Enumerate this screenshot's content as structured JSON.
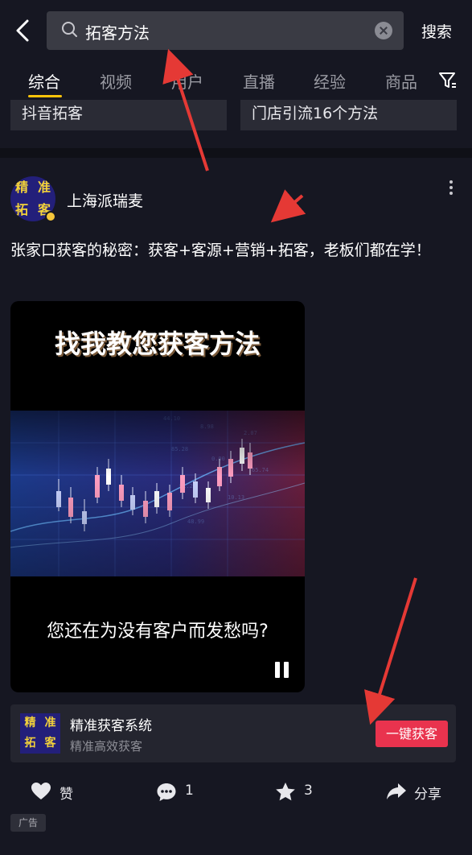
{
  "search": {
    "query": "拓客方法",
    "submit_label": "搜索"
  },
  "tabs": [
    {
      "label": "综合",
      "active": true
    },
    {
      "label": "视频",
      "active": false
    },
    {
      "label": "用户",
      "active": false
    },
    {
      "label": "直播",
      "active": false
    },
    {
      "label": "经验",
      "active": false
    },
    {
      "label": "商品",
      "active": false
    }
  ],
  "related": [
    {
      "label": "抖音拓客"
    },
    {
      "label": "门店引流16个方法"
    }
  ],
  "post": {
    "username": "上海派瑞麦",
    "avatar_text": [
      "精",
      "准",
      "拓",
      "客"
    ],
    "description": "张家口获客的秘密：获客+客源+营销+拓客，老板们都在学！",
    "video": {
      "title": "找我教您获客方法",
      "subtitle": "您还在为没有客户而发愁吗?",
      "state": "playing"
    }
  },
  "ad": {
    "logo_text": [
      "精",
      "准",
      "拓",
      "客"
    ],
    "title": "精准获客系统",
    "subtitle": "精准高效获客",
    "button_label": "一键获客",
    "tag": "广告"
  },
  "actions": {
    "like_label": "赞",
    "comment_count": "1",
    "favorite_count": "3",
    "share_label": "分享"
  },
  "icons": [
    "back-icon",
    "search-icon",
    "clear-icon",
    "filter-icon",
    "more-icon",
    "pause-icon",
    "heart-icon",
    "comment-icon",
    "star-icon",
    "share-icon"
  ],
  "colors": {
    "background": "#161722",
    "accent_tab": "#fec40a",
    "ad_button": "#e9334e",
    "annotation_arrow": "#e53935"
  }
}
